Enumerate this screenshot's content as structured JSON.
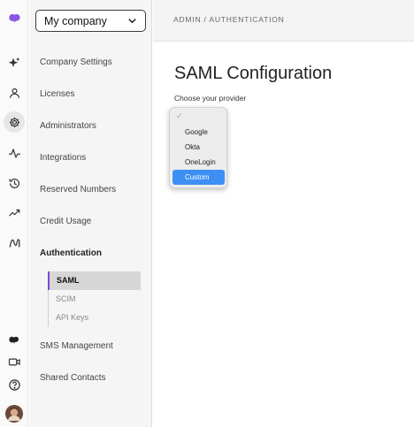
{
  "company": {
    "name": "My company"
  },
  "breadcrumb": "ADMIN / AUTHENTICATION",
  "page": {
    "title": "SAML Configuration",
    "provider_label": "Choose your provider"
  },
  "nav": {
    "items": [
      {
        "label": "Company Settings"
      },
      {
        "label": "Licenses"
      },
      {
        "label": "Administrators"
      },
      {
        "label": "Integrations"
      },
      {
        "label": "Reserved Numbers"
      },
      {
        "label": "Credit Usage"
      },
      {
        "label": "Authentication"
      },
      {
        "label": "SMS Management"
      },
      {
        "label": "Shared Contacts"
      }
    ],
    "sub_items": [
      {
        "label": "SAML"
      },
      {
        "label": "SCIM"
      },
      {
        "label": "API Keys"
      }
    ]
  },
  "dropdown": {
    "check": "✓",
    "options": [
      "Google",
      "Okta",
      "OneLogin",
      "Custom"
    ],
    "selected": "Custom"
  },
  "rail": {
    "icons": [
      "app-logo-icon",
      "sparkle-icon",
      "user-icon",
      "gear-icon",
      "activity-icon",
      "history-icon",
      "trend-icon",
      "ai-icon",
      "chat-icon",
      "video-icon",
      "help-icon",
      "avatar"
    ]
  },
  "colors": {
    "accent": "#7b4ad8",
    "selection": "#3d8ff4"
  }
}
